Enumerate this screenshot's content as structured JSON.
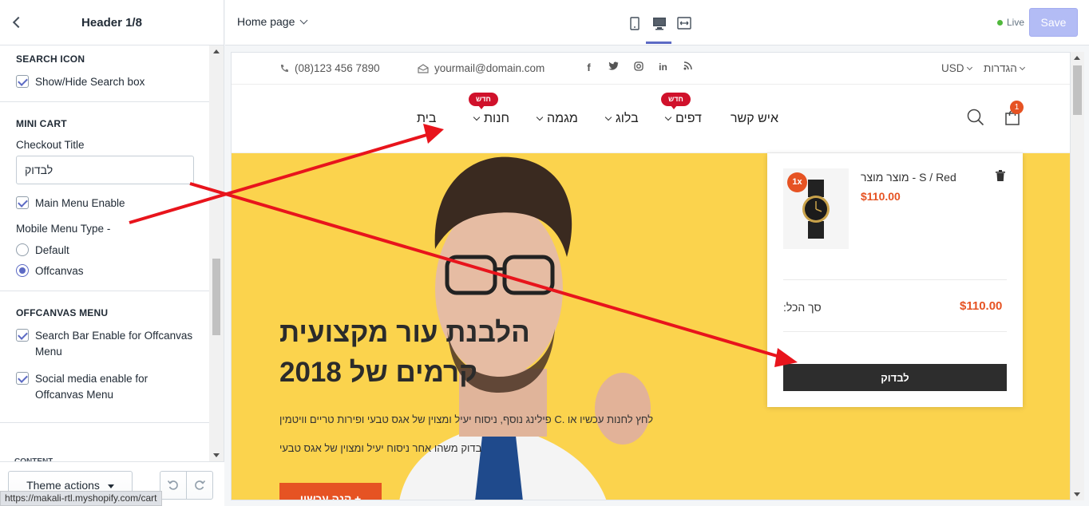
{
  "panel": {
    "title": "Header 1/8",
    "search_icon": {
      "heading": "SEARCH ICON",
      "show_hide": "Show/Hide Search box"
    },
    "mini_cart": {
      "heading": "MINI CART",
      "checkout_title_label": "Checkout Title",
      "checkout_title_value": "לבדוק",
      "main_menu_enable": "Main Menu Enable",
      "mobile_menu_type_label": "Mobile Menu Type -",
      "option_default": "Default",
      "option_offcanvas": "Offcanvas"
    },
    "offcanvas_menu": {
      "heading": "OFFCANVAS MENU",
      "search_bar": "Search Bar Enable for Offcanvas Menu",
      "social_media": "Social media enable for Offcanvas Menu"
    },
    "next_heading_partial": "CONTENT",
    "theme_actions": "Theme actions",
    "status_url": "https://makali-rtl.myshopify.com/cart"
  },
  "topbar": {
    "page_select": "Home page",
    "live": "Live",
    "save": "Save"
  },
  "store": {
    "phone": "(08)123 456 7890",
    "email": "yourmail@domain.com",
    "currency": "USD",
    "settings": "הגדרות",
    "nav": {
      "home": "בית",
      "shop": "חנות",
      "trend": "מגמה",
      "blog": "בלוג",
      "pages": "דפים",
      "contact": "איש קשר",
      "new_badge": "חדש"
    },
    "cart_count": "1",
    "hero": {
      "title_line1": "הלבנת עור מקצועית",
      "title_line2": "קרמים של 2018",
      "text1": "לחץ לחנות עכשיו או .C פילינג נוסף, ניסוח יעיל ומצוין של אגס טבעי ופירות טריים וויטמין",
      "text2": "בדוק משהו אחר ניסוח יעיל ומצוין של אגס טבעי",
      "button": "קנה עכשיו +"
    },
    "mini_cart": {
      "qty": "1x",
      "item_name": "מוצר מוצר - S / Red",
      "item_price": "$110.00",
      "total_label": "סך הכל:",
      "total_value": "$110.00",
      "checkout": "לבדוק"
    }
  }
}
